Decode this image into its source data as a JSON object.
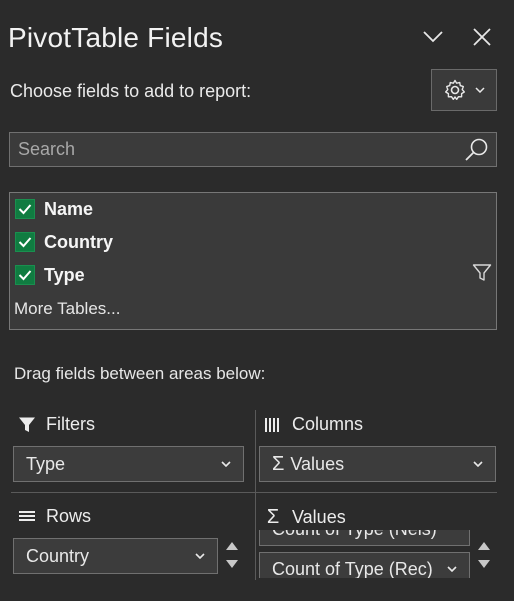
{
  "panel": {
    "title": "PivotTable Fields",
    "choose_label": "Choose fields to add to report:",
    "search_placeholder": "Search",
    "fields": [
      {
        "label": "Name",
        "checked": true
      },
      {
        "label": "Country",
        "checked": true
      },
      {
        "label": "Type",
        "checked": true
      }
    ],
    "more_tables": "More Tables...",
    "drag_label": "Drag fields between areas below:"
  },
  "areas": {
    "filters": {
      "title": "Filters",
      "item": "Type"
    },
    "columns": {
      "title": "Columns",
      "item": "Values"
    },
    "rows": {
      "title": "Rows",
      "item": "Country"
    },
    "values": {
      "title": "Values",
      "items": [
        "Count of Type (Nels)",
        "Count of Type (Rec)"
      ]
    }
  },
  "colors": {
    "background": "#2b2b2b",
    "checkbox_green": "#107c41",
    "border": "#707070"
  },
  "icons": [
    "chevron-down-icon",
    "close-icon",
    "gear-icon",
    "search-icon",
    "checkmark-icon",
    "filter-funnel-icon",
    "columns-icon",
    "rows-icon",
    "sigma-icon",
    "scroll-up-icon",
    "scroll-down-icon"
  ]
}
